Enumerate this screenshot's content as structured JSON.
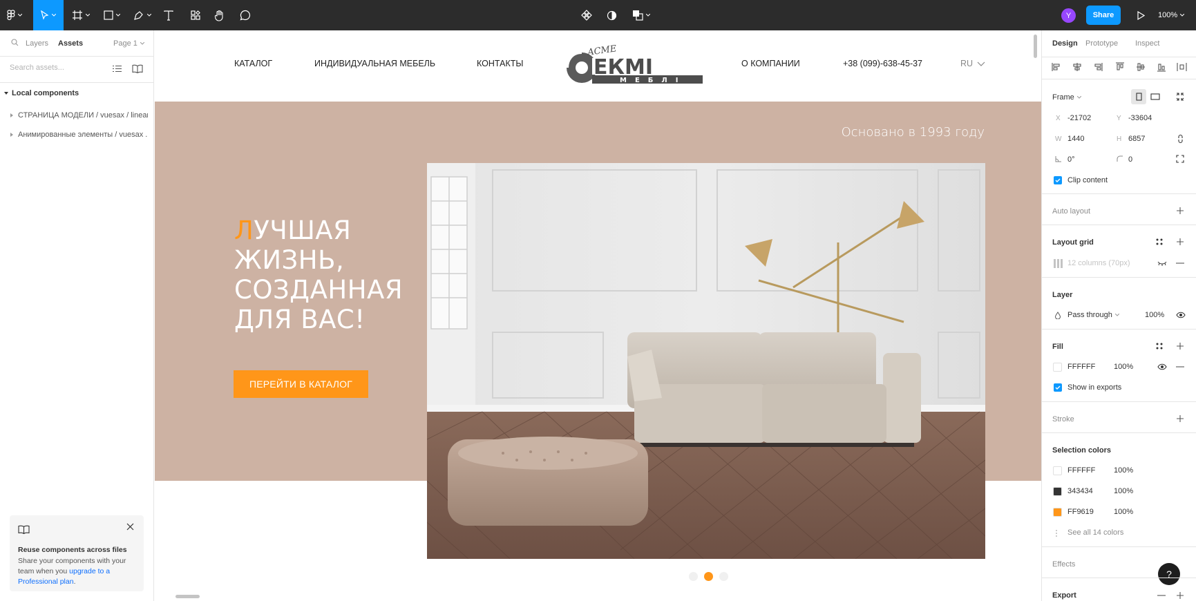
{
  "toolbar": {
    "zoom": "100%",
    "share_label": "Share",
    "user_initial": "Y"
  },
  "left_panel": {
    "tabs": {
      "layers": "Layers",
      "assets": "Assets"
    },
    "page_select": "Page 1",
    "search_placeholder": "Search assets...",
    "local_components_label": "Local components",
    "components": [
      "СТРАНИЦА МОДЕЛИ / vuesax / linear",
      "Анимированные элементы / vuesax ..."
    ],
    "upgrade_card": {
      "title": "Reuse components across files",
      "text_before_link": "Share your components with your team when you ",
      "link_text": "upgrade to a Professional plan",
      "text_after_link": "."
    }
  },
  "site": {
    "nav": {
      "catalog": "КАТАЛОГ",
      "custom_furniture": "ИНДИВИДУАЛЬНАЯ МЕБЕЛЬ",
      "contacts": "КОНТАКТЫ",
      "about": "О КОМПАНИИ",
      "phone": "+38 (099)-638-45-37",
      "language": "RU"
    },
    "logo": {
      "main": "ЕКМІ",
      "sub": "МЕБЛІ",
      "badge": "ACME"
    },
    "founded": "Основано в 1993 году",
    "headline": {
      "first_letter": "Л",
      "line1_rest": "УЧШАЯ",
      "line2": "ЖИЗНЬ,",
      "line3": "СОЗДАННАЯ",
      "line4": "ДЛЯ ВАС!"
    },
    "cta_label": "ПЕРЕЙТИ В КАТАЛОГ",
    "carousel": {
      "slide_count": 3,
      "active_index": 1
    }
  },
  "right_panel": {
    "tabs": {
      "design": "Design",
      "prototype": "Prototype",
      "inspect": "Inspect"
    },
    "frame_label": "Frame",
    "frame": {
      "x": "-21702",
      "y": "-33604",
      "w": "1440",
      "h": "6857",
      "rotation": "0°",
      "radius": "0"
    },
    "field_labels": {
      "x": "X",
      "y": "Y",
      "w": "W",
      "h": "H"
    },
    "clip_content": "Clip content",
    "auto_layout": "Auto layout",
    "layout_grid": "Layout grid",
    "layout_grid_item": "12 columns (70px)",
    "layer": "Layer",
    "blend_mode": "Pass through",
    "layer_opacity": "100%",
    "fill": "Fill",
    "fill_item": {
      "hex": "FFFFFF",
      "opacity": "100%",
      "color": "#ffffff"
    },
    "show_in_exports": "Show in exports",
    "stroke": "Stroke",
    "selection_colors": "Selection colors",
    "colors": [
      {
        "hex": "FFFFFF",
        "opacity": "100%",
        "color": "#ffffff"
      },
      {
        "hex": "343434",
        "opacity": "100%",
        "color": "#343434"
      },
      {
        "hex": "FF9619",
        "opacity": "100%",
        "color": "#ff9619"
      }
    ],
    "see_all_colors": "See all 14 colors",
    "effects": "Effects",
    "export": "Export"
  }
}
